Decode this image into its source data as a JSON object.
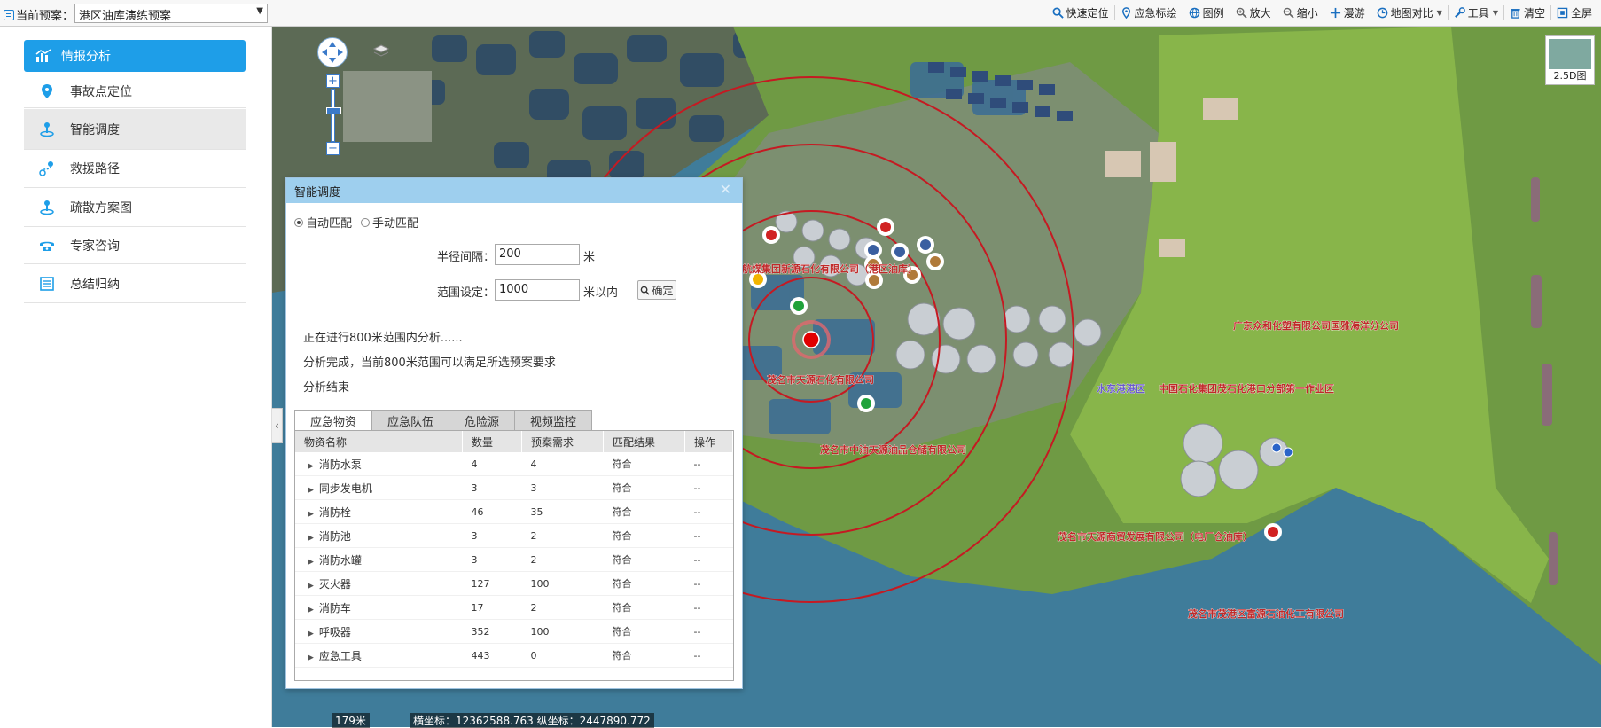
{
  "topbar": {
    "plan_label": "当前预案：",
    "plan_value": "港区油库演练预案",
    "tools": [
      {
        "label": "快速定位",
        "icon": "search-icon"
      },
      {
        "label": "应急标绘",
        "icon": "pin-icon"
      },
      {
        "label": "图例",
        "icon": "globe-icon"
      },
      {
        "label": "放大",
        "icon": "zoom-in-icon"
      },
      {
        "label": "缩小",
        "icon": "zoom-out-icon"
      },
      {
        "label": "漫游",
        "icon": "move-icon"
      },
      {
        "label": "地图对比",
        "icon": "clock-icon"
      },
      {
        "label": "工具",
        "icon": "wrench-icon"
      },
      {
        "label": "清空",
        "icon": "trash-icon"
      },
      {
        "label": "全屏",
        "icon": "fullscreen-icon"
      }
    ]
  },
  "sidebar": {
    "items": [
      {
        "label": "情报分析",
        "icon": "chart-icon"
      },
      {
        "label": "事故点定位",
        "icon": "location-pin-icon"
      },
      {
        "label": "智能调度",
        "icon": "person-pin-icon"
      },
      {
        "label": "救援路径",
        "icon": "route-icon"
      },
      {
        "label": "疏散方案图",
        "icon": "person-pin-icon"
      },
      {
        "label": "专家咨询",
        "icon": "phone-icon"
      },
      {
        "label": "总结归纳",
        "icon": "list-icon"
      }
    ]
  },
  "map": {
    "labels": [
      "中国航煤集团新源石化有限公司（港区油库）",
      "广东众和化塑有限公司国雅海洋分公司",
      "水东港港区",
      "中国石化集团茂石化港口分部第一作业区",
      "茂名市天源石化有限公司",
      "茂名市中油天源油品仓储有限公司",
      "茂名市天源商贸发展有限公司（电厂仓油库）",
      "茂名市茂港区富源石油化工有限公司"
    ],
    "btn_25d": "2.5D图",
    "scale": "179米",
    "coords": "横坐标：12362588.763 纵坐标：2447890.772"
  },
  "dialog": {
    "title": "智能调度",
    "radio_auto": "自动匹配",
    "radio_manual": "手动匹配",
    "radius_label": "半径间隔：",
    "radius_value": "200",
    "radius_unit": "米",
    "range_label": "范围设定：",
    "range_value": "1000",
    "range_unit": "米以内",
    "confirm": "确定",
    "messages": [
      "正在进行800米范围内分析......",
      "分析完成，当前800米范围可以满足所选预案要求",
      "分析结束"
    ],
    "tabs": [
      "应急物资",
      "应急队伍",
      "危险源",
      "视频监控"
    ],
    "table": {
      "headers": [
        "物资名称",
        "数量",
        "预案需求",
        "匹配结果",
        "操作"
      ],
      "rows": [
        [
          "消防水泵",
          "4",
          "4",
          "符合",
          "--"
        ],
        [
          "同步发电机",
          "3",
          "3",
          "符合",
          "--"
        ],
        [
          "消防栓",
          "46",
          "35",
          "符合",
          "--"
        ],
        [
          "消防池",
          "3",
          "2",
          "符合",
          "--"
        ],
        [
          "消防水罐",
          "3",
          "2",
          "符合",
          "--"
        ],
        [
          "灭火器",
          "127",
          "100",
          "符合",
          "--"
        ],
        [
          "消防车",
          "17",
          "2",
          "符合",
          "--"
        ],
        [
          "呼吸器",
          "352",
          "100",
          "符合",
          "--"
        ],
        [
          "应急工具",
          "443",
          "0",
          "符合",
          "--"
        ]
      ]
    }
  }
}
